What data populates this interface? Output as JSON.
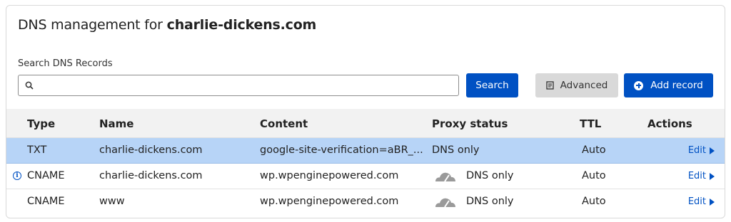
{
  "header": {
    "title_prefix": "DNS management for ",
    "domain": "charlie-dickens.com"
  },
  "search": {
    "label": "Search DNS Records",
    "value": "",
    "placeholder": "",
    "button_label": "Search"
  },
  "toolbar": {
    "advanced_label": "Advanced",
    "add_record_label": "Add record"
  },
  "table": {
    "columns": [
      "Type",
      "Name",
      "Content",
      "Proxy status",
      "TTL",
      "Actions"
    ],
    "rows": [
      {
        "type": "TXT",
        "name": "charlie-dickens.com",
        "content": "google-site-verification=aBR_...",
        "proxy": "DNS only",
        "ttl": "Auto",
        "action": "Edit"
      },
      {
        "type": "CNAME",
        "name": "charlie-dickens.com",
        "content": "wp.wpenginepowered.com",
        "proxy": "DNS only",
        "ttl": "Auto",
        "action": "Edit"
      },
      {
        "type": "CNAME",
        "name": "www",
        "content": "wp.wpenginepowered.com",
        "proxy": "DNS only",
        "ttl": "Auto",
        "action": "Edit"
      }
    ]
  },
  "colors": {
    "accent": "#0051c3",
    "selected_row": "#b7d4f7",
    "header_bg": "#f2f2f2",
    "cloud_gray": "#9a9a9a"
  },
  "icons": [
    "search-icon",
    "document-icon",
    "plus-circle-icon",
    "info-icon",
    "cloud-icon",
    "caret-right-icon"
  ]
}
